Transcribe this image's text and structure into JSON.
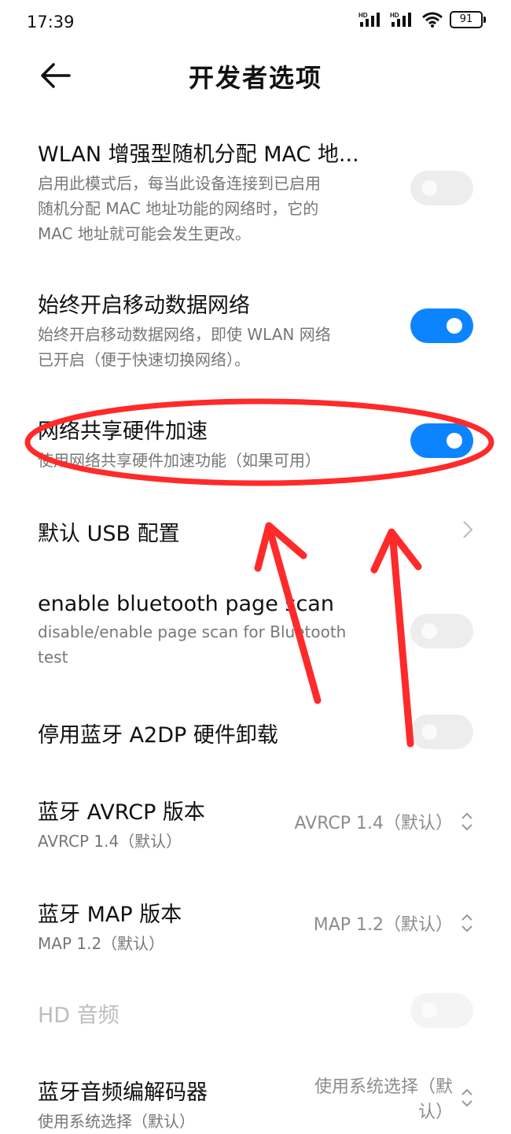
{
  "status_bar": {
    "time": "17:39",
    "signal1_label": "HD",
    "signal2_label": "HD",
    "battery": "91",
    "icons": [
      "signal-hd-icon",
      "signal-hd-icon",
      "wifi-icon",
      "battery-icon"
    ]
  },
  "header": {
    "title": "开发者选项",
    "back_icon": "back-arrow-icon"
  },
  "settings": [
    {
      "title": "WLAN 增强型随机分配 MAC 地...",
      "subtitle_lines": [
        "启用此模式后，每当此设备连接到已启用",
        "随机分配 MAC 地址功能的网络时，它的",
        "MAC 地址就可能会发生更改。"
      ],
      "toggle": "off"
    },
    {
      "title": "始终开启移动数据网络",
      "subtitle_lines": [
        "始终开启移动数据网络，即使 WLAN 网络",
        "已开启（便于快速切换网络）。"
      ],
      "toggle": "on"
    },
    {
      "title": "网络共享硬件加速",
      "subtitle_lines": [
        "使用网络共享硬件加速功能（如果可用）"
      ],
      "toggle": "on"
    },
    {
      "title": "默认 USB 配置",
      "chevron_icon": "chevron-right-icon"
    },
    {
      "title": "enable bluetooth page scan",
      "subtitle_lines": [
        "disable/enable page scan for Bluetooth",
        "test"
      ],
      "toggle": "off"
    },
    {
      "title": "停用蓝牙 A2DP 硬件卸载",
      "toggle": "off"
    },
    {
      "title": "蓝牙 AVRCP 版本",
      "subtitle_lines": [
        "AVRCP 1.4（默认）"
      ],
      "value": "AVRCP 1.4（默认）"
    },
    {
      "title": "蓝牙 MAP 版本",
      "subtitle_lines": [
        "MAP 1.2（默认）"
      ],
      "value": "MAP 1.2（默认）"
    },
    {
      "title": "HD 音频",
      "toggle": "off",
      "disabled": true
    },
    {
      "title": "蓝牙音频编解码器",
      "subtitle_lines": [
        "使用系统选择（默认）"
      ],
      "value_lines": [
        "使用系统选择（默",
        "认）"
      ]
    }
  ],
  "colors": {
    "accent": "#0d84ff",
    "annotation": "#ff2a2a"
  }
}
